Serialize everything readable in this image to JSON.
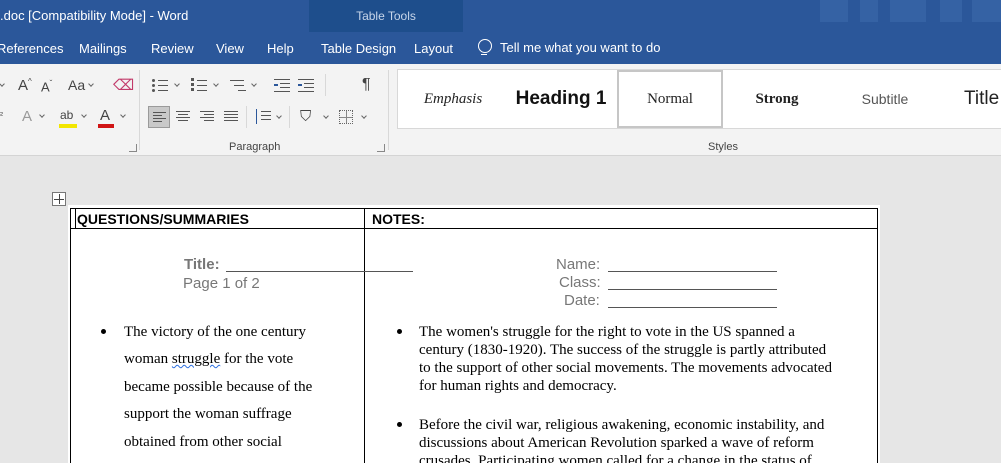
{
  "titlebar": {
    "doc_title": ".doc [Compatibility Mode]  -  Word",
    "contextual_label": "Table Tools"
  },
  "tabs": [
    "References",
    "Mailings",
    "Review",
    "View",
    "Help",
    "Table Design",
    "Layout"
  ],
  "tell_me": "Tell me what you want to do",
  "ribbon": {
    "paragraph_label": "Paragraph",
    "styles_label": "Styles",
    "change_case": "Aa",
    "pilcrow": "¶"
  },
  "styles": {
    "emphasis": "Emphasis",
    "heading1": "Heading 1",
    "normal": "Normal",
    "strong": "Strong",
    "subtitle": "Subtitle",
    "title": "Title"
  },
  "document": {
    "col1_header": "QUESTIONS/SUMMARIES",
    "col2_header": "NOTES:",
    "title_label": "Title:",
    "page_info": "Page 1 of 2",
    "name_label": "Name:",
    "class_label": "Class:",
    "date_label": "Date:",
    "left_lines": [
      "The victory of the one century",
      "woman",
      "struggle",
      "for the vote",
      "became possible because of the",
      "support the woman suffrage",
      "obtained from other social"
    ],
    "right_bullet1": [
      "The women's struggle for the right to vote in the US spanned a",
      "century (1830-1920).  The success of the struggle is partly attributed",
      "to the support of other social movements. The movements advocated",
      "for human rights and democracy."
    ],
    "right_bullet2": [
      "Before the civil war, religious awakening, economic instability, and",
      "discussions about American Revolution sparked a wave of reform",
      "crusades. Participating women called for a change in the status of"
    ]
  },
  "colors": {
    "accent": "#2b579a",
    "contextual": "#1e4e8c"
  }
}
